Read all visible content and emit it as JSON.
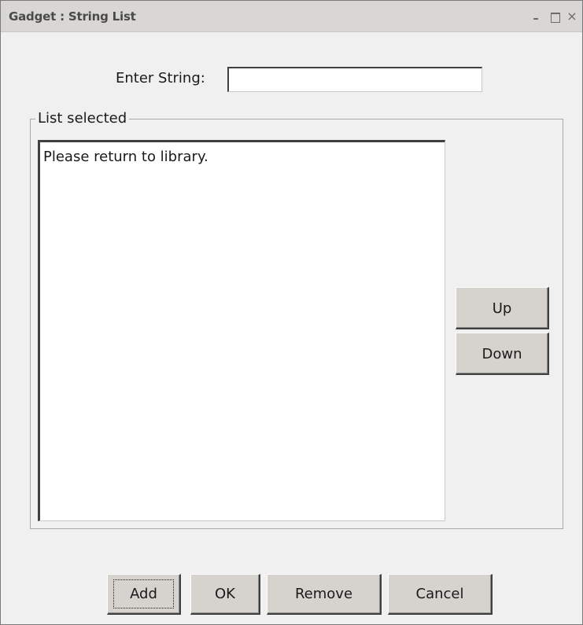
{
  "window": {
    "title": "Gadget : String List",
    "controls": {
      "minimize_icon": "minimize-icon",
      "maximize_icon": "maximize-icon",
      "close_icon": "close-icon",
      "close_glyph": "×"
    }
  },
  "form": {
    "enter_label": "Enter String:",
    "enter_value": "",
    "enter_placeholder": ""
  },
  "group": {
    "legend": "List selected",
    "items": [
      "Please return to library."
    ]
  },
  "side_buttons": {
    "up": "Up",
    "down": "Down"
  },
  "footer_buttons": {
    "add": "Add",
    "ok": "OK",
    "remove": "Remove",
    "cancel": "Cancel"
  },
  "colors": {
    "titlebar": "#d9d7d3",
    "window_bg": "#f0f0f0",
    "button_face": "#d6d3ce"
  }
}
